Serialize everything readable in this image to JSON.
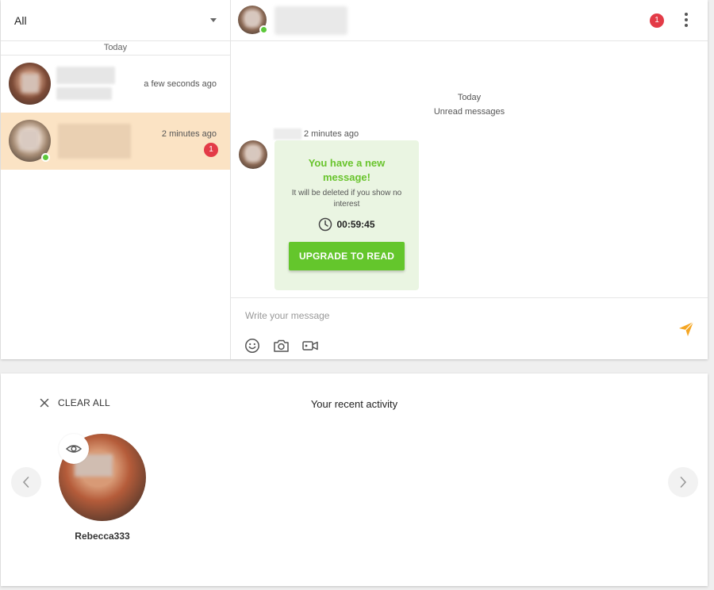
{
  "sidebar": {
    "filter_label": "All",
    "day_separator": "Today",
    "conversations": [
      {
        "time": "a few seconds ago",
        "online": false,
        "unread": ""
      },
      {
        "time": "2 minutes ago",
        "online": true,
        "unread": "1"
      }
    ]
  },
  "chat": {
    "header_badge": "1",
    "today_label": "Today",
    "unread_label": "Unread messages",
    "sender_time": "2 minutes ago",
    "bubble": {
      "title": "You have a new message!",
      "subtitle": "It will be deleted if you show no interest",
      "timer": "00:59:45",
      "button_label": "UPGRADE TO READ"
    },
    "composer": {
      "placeholder": "Write your message",
      "value": ""
    }
  },
  "activity": {
    "clear_all_label": "CLEAR ALL",
    "title": "Your recent activity",
    "profiles": [
      {
        "name": "Rebecca333"
      }
    ]
  },
  "colors": {
    "accent_green": "#64c62c",
    "badge_red": "#e33b47",
    "active_conversation": "#fbe3c4",
    "send_orange": "#f5a623",
    "online_green": "#5cc83a"
  },
  "icons": {
    "caret": "caret-down-icon",
    "more": "more-vertical-icon",
    "clock": "clock-icon",
    "emoji": "emoji-icon",
    "camera": "camera-icon",
    "video": "video-camera-icon",
    "send": "send-icon",
    "close": "close-icon",
    "eye": "eye-icon",
    "prev": "chevron-left-icon",
    "next": "chevron-right-icon"
  }
}
